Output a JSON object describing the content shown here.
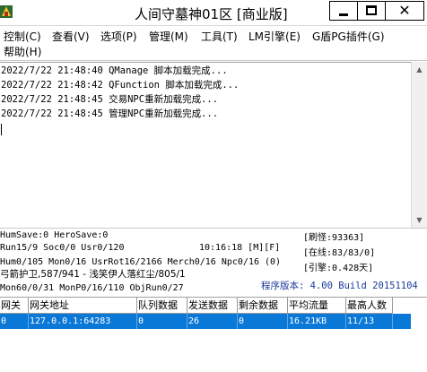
{
  "window": {
    "title": "人间守墓神01区 [商业版]",
    "minimize_icon": "minimize-icon",
    "maximize_icon": "maximize-icon",
    "close_icon": "close-icon",
    "close_glyph": "✕"
  },
  "menu": {
    "items": [
      "控制(C)",
      "查看(V)",
      "选项(P)",
      "管理(M)",
      "工具(T)",
      "LM引擎(E)",
      "G盾PG插件(G)",
      "帮助(H)"
    ]
  },
  "log": {
    "lines": [
      "2022/7/22 21:48:40 QManage 脚本加载完成...",
      "2022/7/22 21:48:42 QFunction 脚本加载完成...",
      "2022/7/22 21:48:45 交易NPC重新加载完成...",
      "2022/7/22 21:48:45 管理NPC重新加载完成..."
    ]
  },
  "status": {
    "line1": "HumSave:0 HeroSave:0",
    "line2": "Run15/9 Soc0/0 Usr0/120",
    "time": "10:16:18 [M][F]",
    "line3": "Hum0/105 Mon0/16 UsrRot16/2166 Merch0/16 Npc0/16 (0)",
    "line4": "弓箭护卫,587/941 - 浅笑伊人落红尘/805/1",
    "line5": "Mon60/0/31 MonP0/16/110 ObjRun0/27",
    "monsters": "[刷怪:93363]",
    "online": "[在线:83/83/0]",
    "engine": "[引擎:0.428天]",
    "version": "程序版本: 4.00 Build 20151104"
  },
  "grid": {
    "headers": [
      "网关",
      "网关地址",
      "队列数据",
      "发送数据",
      "剩余数据",
      "平均流量",
      "最高人数"
    ],
    "rows": [
      [
        "0",
        "127.0.0.1:64283",
        "0",
        "26",
        "0",
        "16.21KB",
        "11/13"
      ]
    ]
  },
  "colors": {
    "selection": "#0a78d7",
    "version_text": "#1a3a9a"
  }
}
